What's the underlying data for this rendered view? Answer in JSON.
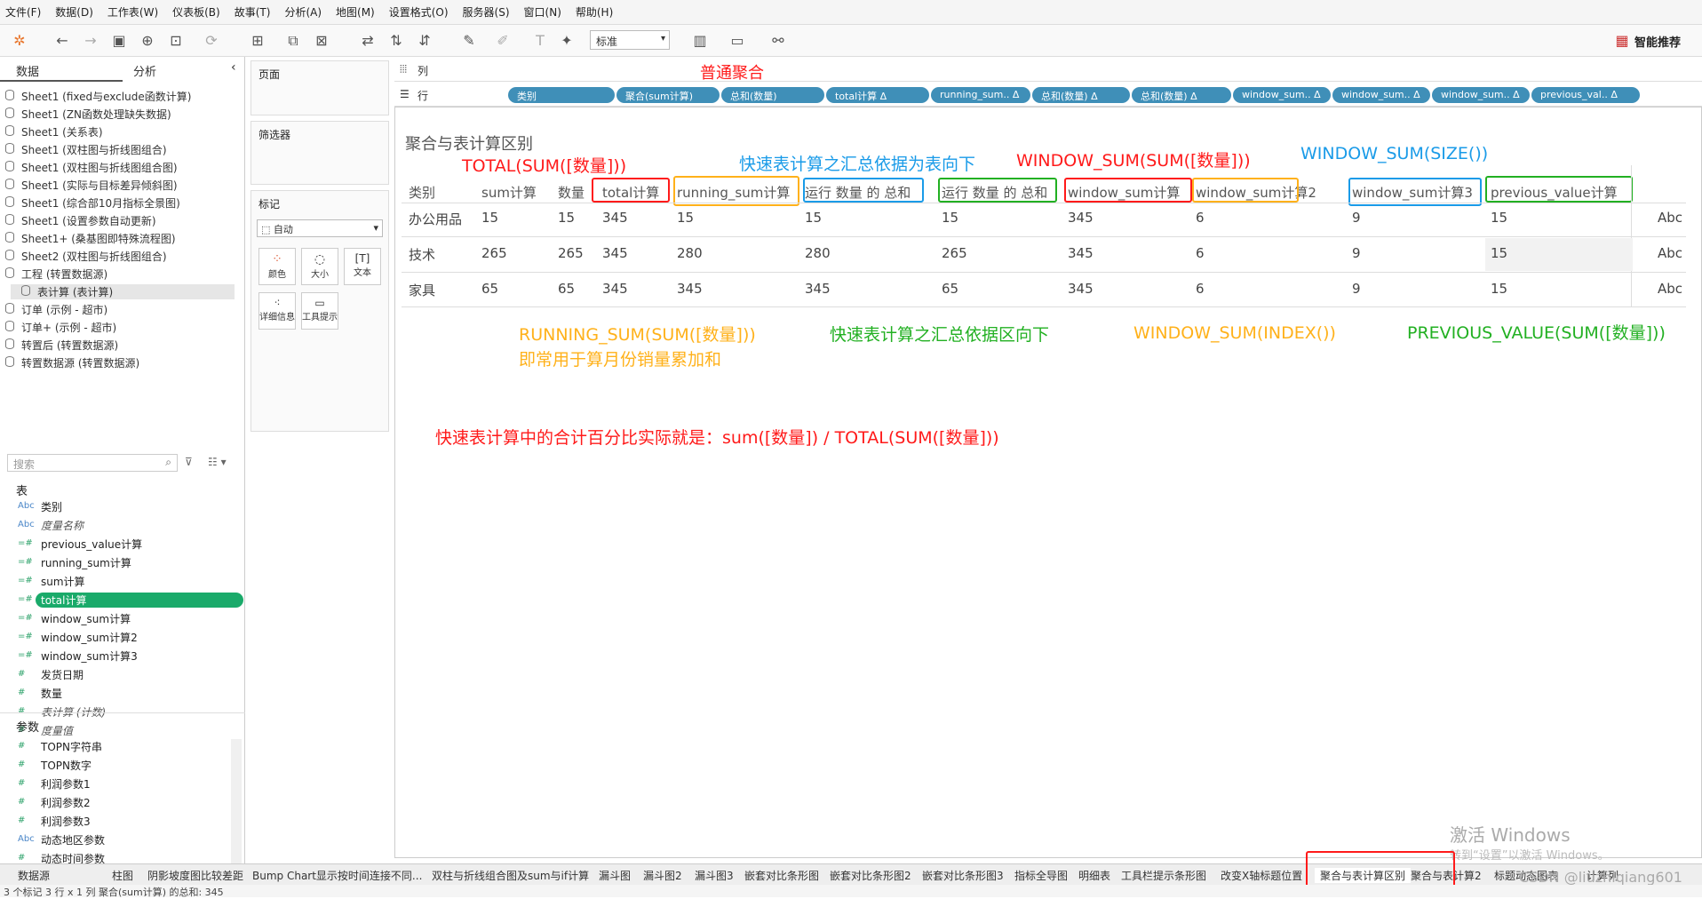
{
  "menu": [
    "文件(F)",
    "数据(D)",
    "工作表(W)",
    "仪表板(B)",
    "故事(T)",
    "分析(A)",
    "地图(M)",
    "设置格式(O)",
    "服务器(S)",
    "窗口(N)",
    "帮助(H)"
  ],
  "toolbar": {
    "std_label": "标准",
    "smart_label": "智能推荐"
  },
  "left": {
    "tab_data": "数据",
    "tab_analysis": "分析",
    "datasources": [
      "Sheet1 (fixed与exclude函数计算)",
      "Sheet1 (ZN函数处理缺失数据)",
      "Sheet1 (关系表)",
      "Sheet1 (双柱图与折线图组合)",
      "Sheet1 (双柱图与折线图组合图)",
      "Sheet1 (实际与目标差异倾斜图)",
      "Sheet1 (综合部10月指标全景图)",
      "Sheet1 (设置参数自动更新)",
      "Sheet1+ (桑基图即特殊流程图)",
      "Sheet2 (双柱图与折线图组合)",
      "工程 (转置数据源)",
      "表计算 (表计算)",
      "订单 (示例 - 超市)",
      "订单+ (示例 - 超市)",
      "转置后 (转置数据源)",
      "转置数据源 (转置数据源)"
    ],
    "search_placeholder": "搜索",
    "table_title": "表",
    "fields": [
      {
        "type": "Abc",
        "name": "类别"
      },
      {
        "type": "Abc",
        "name": "度量名称"
      },
      {
        "type": "=#",
        "name": "previous_value计算"
      },
      {
        "type": "=#",
        "name": "running_sum计算"
      },
      {
        "type": "=#",
        "name": "sum计算"
      },
      {
        "type": "=#",
        "name": "total计算"
      },
      {
        "type": "=#",
        "name": "window_sum计算"
      },
      {
        "type": "=#",
        "name": "window_sum计算2"
      },
      {
        "type": "=#",
        "name": "window_sum计算3"
      },
      {
        "type": "#",
        "name": "发货日期"
      },
      {
        "type": "#",
        "name": "数量"
      },
      {
        "type": "#",
        "name": "表计算 (计数)"
      },
      {
        "type": "#",
        "name": "度量值"
      }
    ],
    "params_title": "参数",
    "params": [
      {
        "type": "#",
        "name": "TOPN字符串"
      },
      {
        "type": "#",
        "name": "TOPN数字"
      },
      {
        "type": "#",
        "name": "利润参数1"
      },
      {
        "type": "#",
        "name": "利润参数2"
      },
      {
        "type": "#",
        "name": "利润参数3"
      },
      {
        "type": "Abc",
        "name": "动态地区参数"
      },
      {
        "type": "#",
        "name": "动态时间参数"
      }
    ]
  },
  "mid": {
    "pages": "页面",
    "filters": "筛选器",
    "marks": "标记",
    "mark_type": "自动",
    "mark_buttons": [
      "颜色",
      "大小",
      "文本",
      "详细信息",
      "工具提示"
    ]
  },
  "shelves": {
    "col_label": "列",
    "row_label": "行",
    "col_note": "普通聚合",
    "row_pills": [
      "类别",
      "聚合(sum计算)",
      "总和(数量)",
      "total计算 Δ",
      "running_sum.. Δ",
      "总和(数量) Δ",
      "总和(数量) Δ",
      "window_sum.. Δ",
      "window_sum.. Δ",
      "window_sum.. Δ",
      "previous_val.. Δ"
    ]
  },
  "sheet": {
    "title": "聚合与表计算区别",
    "headers": [
      "类别",
      "sum计算",
      "数量",
      "total计算",
      "running_sum计算",
      "运行 数量 的 总和",
      "运行 数量 的 总和",
      "window_sum计算",
      "window_sum计算2",
      "window_sum计算3",
      "previous_value计算"
    ],
    "rows": [
      [
        "办公用品",
        "15",
        "15",
        "345",
        "15",
        "15",
        "15",
        "345",
        "6",
        "9",
        "15",
        "Abc"
      ],
      [
        "技术",
        "265",
        "265",
        "345",
        "280",
        "280",
        "265",
        "345",
        "6",
        "9",
        "15",
        "Abc"
      ],
      [
        "家具",
        "65",
        "65",
        "345",
        "345",
        "345",
        "65",
        "345",
        "6",
        "9",
        "15",
        "Abc"
      ]
    ]
  },
  "annotations": {
    "total": "TOTAL(SUM([数量]))",
    "quick_table_down": "快速表计算之汇总依据为表向下",
    "window_sum_sum": "WINDOW_SUM(SUM([数量]))",
    "window_sum_size": "WINDOW_SUM(SIZE())",
    "running_sum": "RUNNING_SUM(SUM([数量]))",
    "running_sum_note": "即常用于算月份销量累加和",
    "quick_pane_down": "快速表计算之汇总依据区向下",
    "window_sum_index": "WINDOW_SUM(INDEX())",
    "previous_value": "PREVIOUS_VALUE(SUM([数量]))",
    "percent_note": "快速表计算中的合计百分比实际就是：sum([数量]) / TOTAL(SUM([数量]))"
  },
  "watermark": {
    "line1": "激活 Windows",
    "line2": "转到“设置”以激活 Windows。",
    "csdn": "CSDN @liuzhiqiang601"
  },
  "tabs": [
    "数据源",
    "柱图",
    "阴影坡度图比较差距",
    "Bump Chart显示按时间连接不同...",
    "双柱与折线组合图及sum与if计算",
    "漏斗图",
    "漏斗图2",
    "漏斗图3",
    "嵌套对比条形图",
    "嵌套对比条形图2",
    "嵌套对比条形图3",
    "指标全导图",
    "明细表",
    "工具栏提示条形图",
    "改变X轴标题位置",
    "聚合与表计算区别",
    "聚合与表计算2",
    "标题动态图表",
    "计算列"
  ],
  "status": "3 个标记    3 行 x 1 列    聚合(sum计算) 的总和: 345",
  "colors": {
    "accent_pill": "#3f8fb8",
    "selected_field": "#1aaa6a",
    "red": "#ff1a1a",
    "blue": "#1a9be8",
    "orange": "#ffb11a",
    "green": "#22b022"
  }
}
